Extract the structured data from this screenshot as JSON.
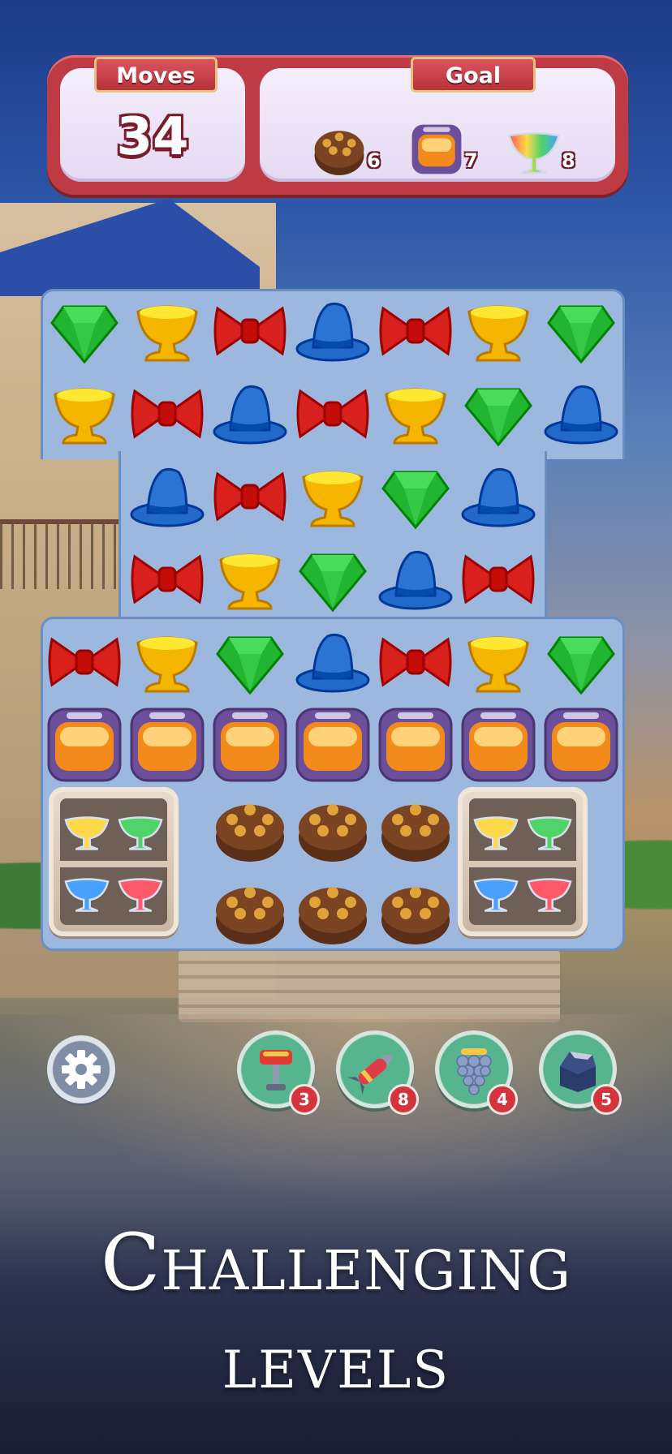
{
  "hud": {
    "moves_label": "Moves",
    "moves_value": "34",
    "goal_label": "Goal",
    "goals": [
      {
        "icon": "chocolate-cake-icon",
        "count": "6"
      },
      {
        "icon": "lantern-crate-icon",
        "count": "7"
      },
      {
        "icon": "rainbow-cup-icon",
        "count": "8"
      }
    ]
  },
  "board": {
    "rows": [
      [
        "gem",
        "cup",
        "bow",
        "hat",
        "bow",
        "cup",
        "gem"
      ],
      [
        "cup",
        "bow",
        "hat",
        "bow",
        "cup",
        "gem",
        "hat"
      ],
      [
        null,
        "hat",
        "bow",
        "cup",
        "gem",
        "hat",
        null
      ],
      [
        null,
        "bow",
        "cup",
        "gem",
        "hat",
        "bow",
        null
      ],
      [
        "bow",
        "cup",
        "gem",
        "hat",
        "bow",
        "cup",
        "gem"
      ],
      [
        "crate",
        "crate",
        "crate",
        "crate",
        "crate",
        "crate",
        "crate"
      ],
      [
        "shelf",
        "shelf",
        "cake",
        "cake",
        "cake",
        "shelf",
        "shelf"
      ],
      [
        "shelf",
        "shelf",
        "cake",
        "cake",
        "cake",
        "shelf",
        "shelf"
      ]
    ]
  },
  "colors": {
    "gem": "#22b532",
    "cup": "#f6b600",
    "bow": "#d8211d",
    "hat": "#2c74d4"
  },
  "boosters": [
    {
      "icon": "hammer-icon",
      "count": "3"
    },
    {
      "icon": "rocket-icon",
      "count": "8"
    },
    {
      "icon": "grapes-icon",
      "count": "4"
    },
    {
      "icon": "open-box-icon",
      "count": "5"
    }
  ],
  "promo": {
    "line1": "Challenging",
    "line2": "levels"
  }
}
